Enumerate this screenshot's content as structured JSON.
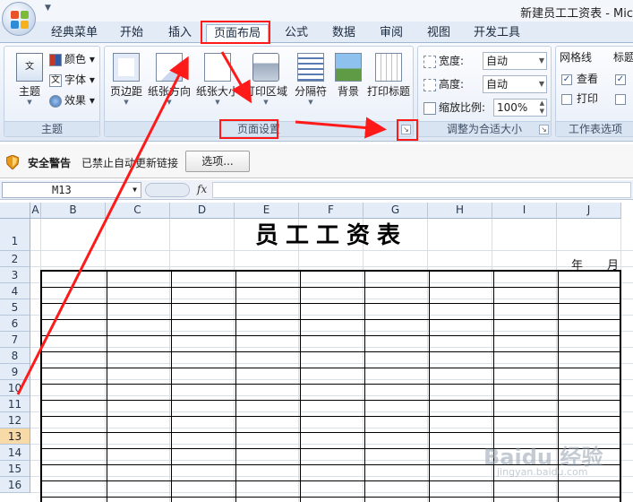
{
  "window": {
    "title": "新建员工工资表 - Mic"
  },
  "tabs": [
    {
      "label": "经典菜单"
    },
    {
      "label": "开始"
    },
    {
      "label": "插入"
    },
    {
      "label": "页面布局",
      "active": true
    },
    {
      "label": "公式"
    },
    {
      "label": "数据"
    },
    {
      "label": "审阅"
    },
    {
      "label": "视图"
    },
    {
      "label": "开发工具"
    }
  ],
  "ribbon": {
    "theme_group": {
      "label": "主题",
      "theme_button": "主题",
      "colors": "颜色",
      "fonts": "字体",
      "effects": "效果"
    },
    "page_setup_group": {
      "label": "页面设置",
      "margins": "页边距",
      "orientation": "纸张方向",
      "size": "纸张大小",
      "print_area": "打印区域",
      "breaks": "分隔符",
      "background": "背景",
      "print_titles": "打印标题"
    },
    "scale_group": {
      "label": "调整为合适大小",
      "width_label": "宽度:",
      "width_value": "自动",
      "height_label": "高度:",
      "height_value": "自动",
      "scale_label": "缩放比例:",
      "scale_value": "100%"
    },
    "sheet_options_group": {
      "label": "工作表选项",
      "gridlines": "网格线",
      "view": "查看",
      "print": "打印",
      "headings": "标题",
      "gridlines_view_checked": true,
      "gridlines_print_checked": false
    }
  },
  "security_bar": {
    "title": "安全警告",
    "message": "已禁止自动更新链接",
    "options_button": "选项..."
  },
  "formula_bar": {
    "name_box": "M13",
    "fx": "fx",
    "formula": ""
  },
  "sheet": {
    "columns": [
      "A",
      "B",
      "C",
      "D",
      "E",
      "F",
      "G",
      "H",
      "I",
      "J"
    ],
    "rows": [
      "1",
      "2",
      "3",
      "4",
      "5",
      "6",
      "7",
      "8",
      "9",
      "10",
      "11",
      "12",
      "13",
      "14",
      "15",
      "16"
    ],
    "selected_row": "13",
    "title": "员工工资表",
    "year_label": "年",
    "month_label": "月"
  },
  "watermark": {
    "text": "Baidu 经验",
    "sub": "jingyan.baidu.com"
  },
  "colors": {
    "accent": "#ff1a1a",
    "ribbon_bg": "#e9eff8",
    "header_bg": "#e4ecf7"
  }
}
